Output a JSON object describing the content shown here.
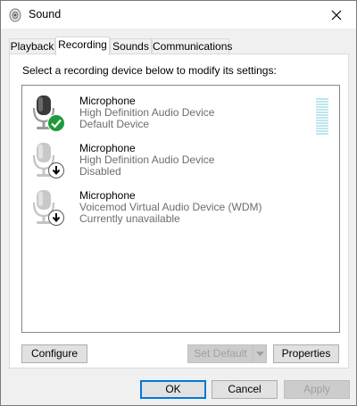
{
  "window": {
    "title": "Sound"
  },
  "tabs": [
    {
      "label": "Playback"
    },
    {
      "label": "Recording"
    },
    {
      "label": "Sounds"
    },
    {
      "label": "Communications"
    }
  ],
  "recording": {
    "instruction": "Select a recording device below to modify its settings:",
    "devices": [
      {
        "name": "Microphone",
        "description": "High Definition Audio Device",
        "status": "Default Device",
        "status_icon": "check-icon"
      },
      {
        "name": "Microphone",
        "description": "High Definition Audio Device",
        "status": "Disabled",
        "status_icon": "arrow-down-icon"
      },
      {
        "name": "Microphone",
        "description": "Voicemod Virtual Audio Device (WDM)",
        "status": "Currently unavailable",
        "status_icon": "arrow-down-icon"
      }
    ],
    "configure_label": "Configure",
    "set_default_label": "Set Default",
    "properties_label": "Properties"
  },
  "footer": {
    "ok_label": "OK",
    "cancel_label": "Cancel",
    "apply_label": "Apply"
  },
  "colors": {
    "accent": "#0078d7",
    "check_green": "#1e9a3c",
    "level_meter": "#bfe6ee"
  }
}
